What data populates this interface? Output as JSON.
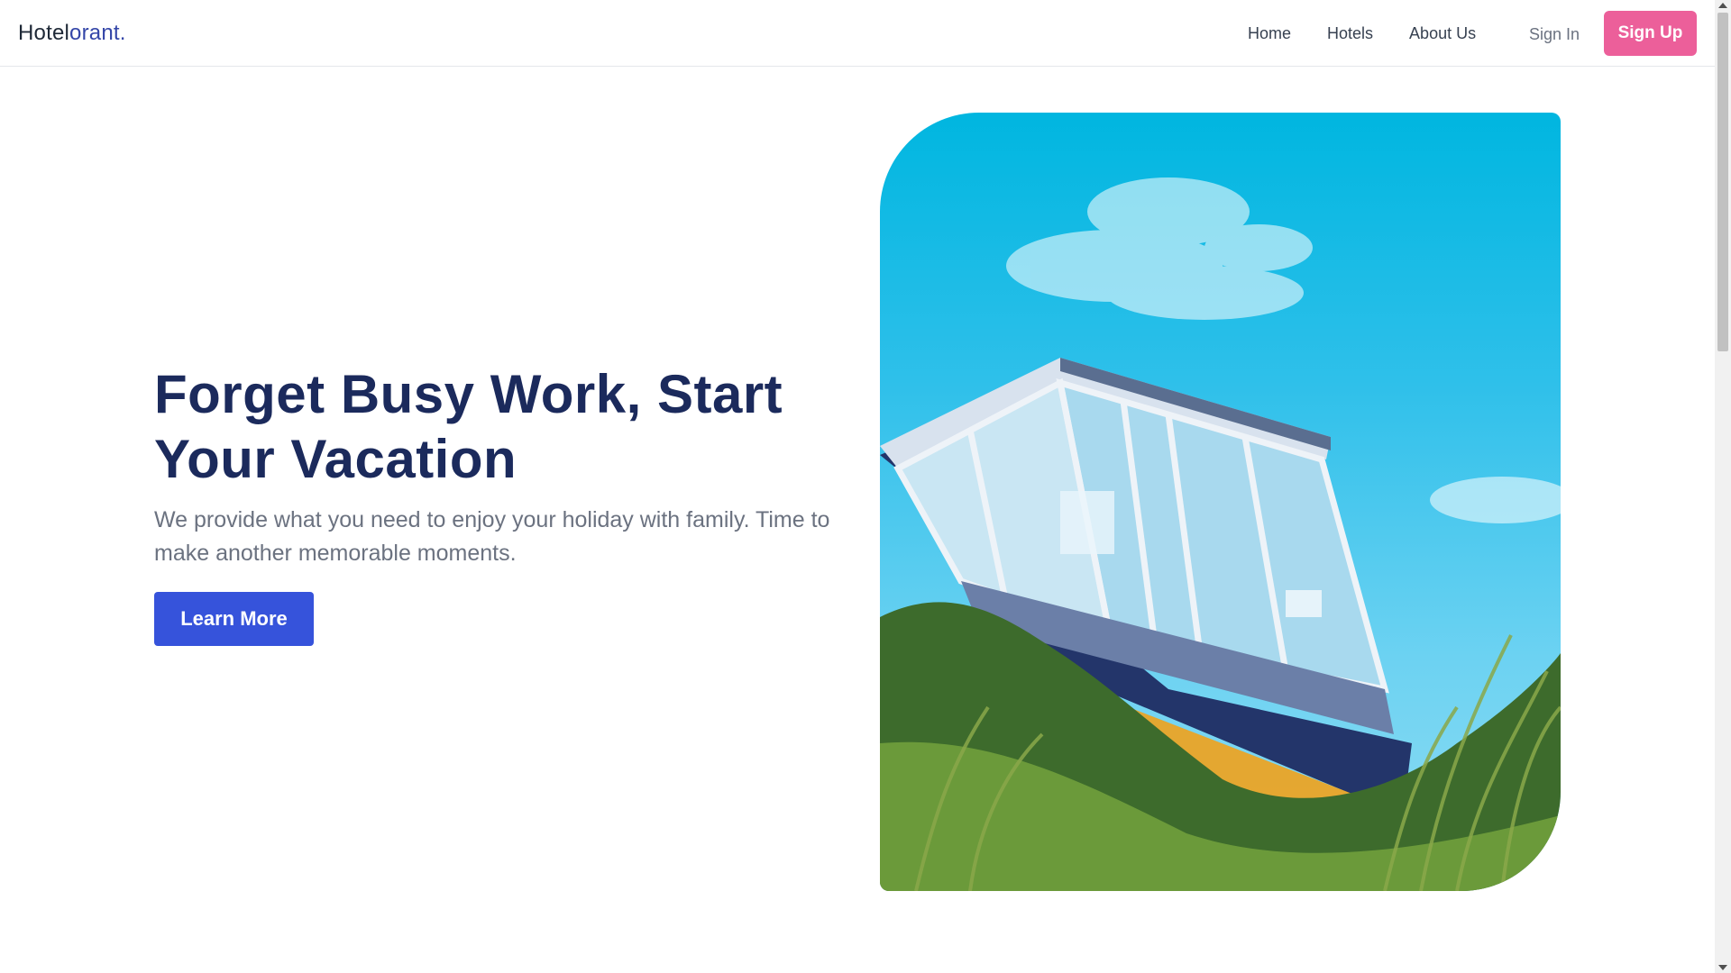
{
  "header": {
    "logo_part1": "Hotel",
    "logo_part2": "orant.",
    "nav": [
      {
        "label": "Home"
      },
      {
        "label": "Hotels"
      },
      {
        "label": "About Us"
      }
    ],
    "signin_label": "Sign In",
    "signup_label": "Sign Up"
  },
  "hero": {
    "title": "Forget Busy Work, Start Your Vacation",
    "subtitle": "We provide what you need to enjoy your holiday with family. Time to make another memorable moments.",
    "cta_label": "Learn More"
  },
  "colors": {
    "brand": "#3446a8",
    "title": "#1b2a5c",
    "signup_bg": "#ec5f9a",
    "cta_bg": "#3653db",
    "sky": "#00b6e0"
  }
}
